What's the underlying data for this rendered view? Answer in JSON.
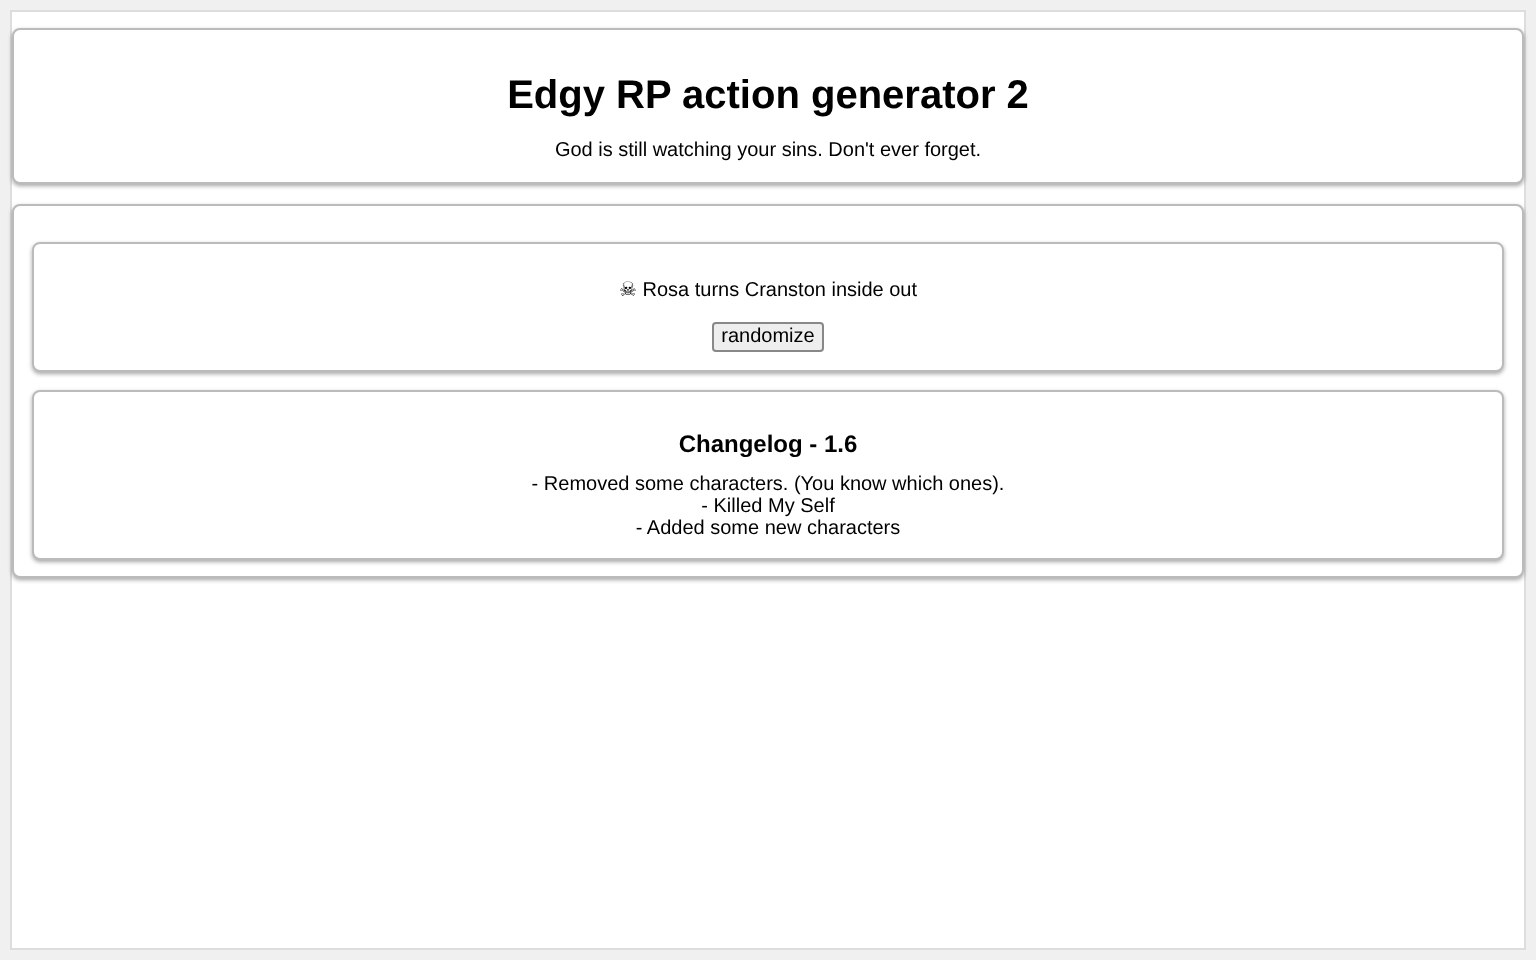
{
  "header": {
    "title": "Edgy RP action generator 2",
    "subtitle": "God is still watching your sins. Don't ever forget."
  },
  "generator": {
    "action": "☠ Rosa turns Cranston inside out",
    "button": "randomize"
  },
  "changelog": {
    "title": "Changelog - 1.6",
    "lines": [
      "- Removed some characters. (You know which ones).",
      "- Killed My Self",
      "- Added some new characters"
    ]
  }
}
